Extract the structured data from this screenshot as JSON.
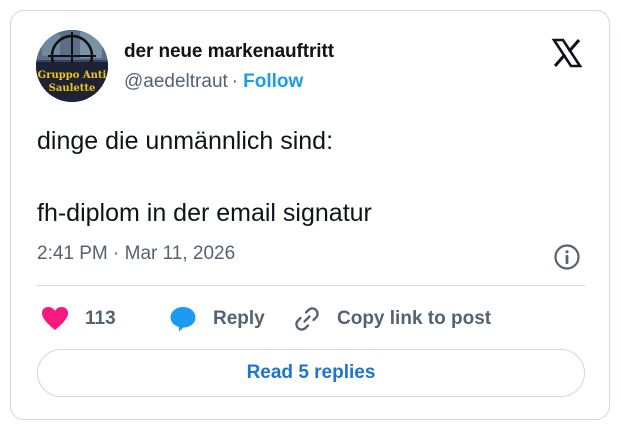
{
  "author": {
    "display_name": "der neue markenauftritt",
    "handle": "@aedeltraut",
    "separator": "·",
    "follow_label": "Follow",
    "avatar_text": "Gruppo Anti Saulette"
  },
  "tweet": {
    "text": "dinge die unmännlich sind:\n\nfh-diplom in der email signatur",
    "timestamp": "2:41 PM · Mar 11, 2026"
  },
  "actions": {
    "like_count": "113",
    "reply_label": "Reply",
    "copy_label": "Copy link to post"
  },
  "read_replies_label": "Read 5 replies",
  "icons": {
    "logo": "x-logo-icon",
    "info": "info-icon",
    "like": "heart-icon",
    "reply": "speech-bubble-icon",
    "copy": "link-icon"
  },
  "colors": {
    "accent": "#1d9bf0",
    "like": "#f91880",
    "reply_icon": "#1d9bf0",
    "muted_text": "#536471",
    "border": "#cfd9de"
  }
}
